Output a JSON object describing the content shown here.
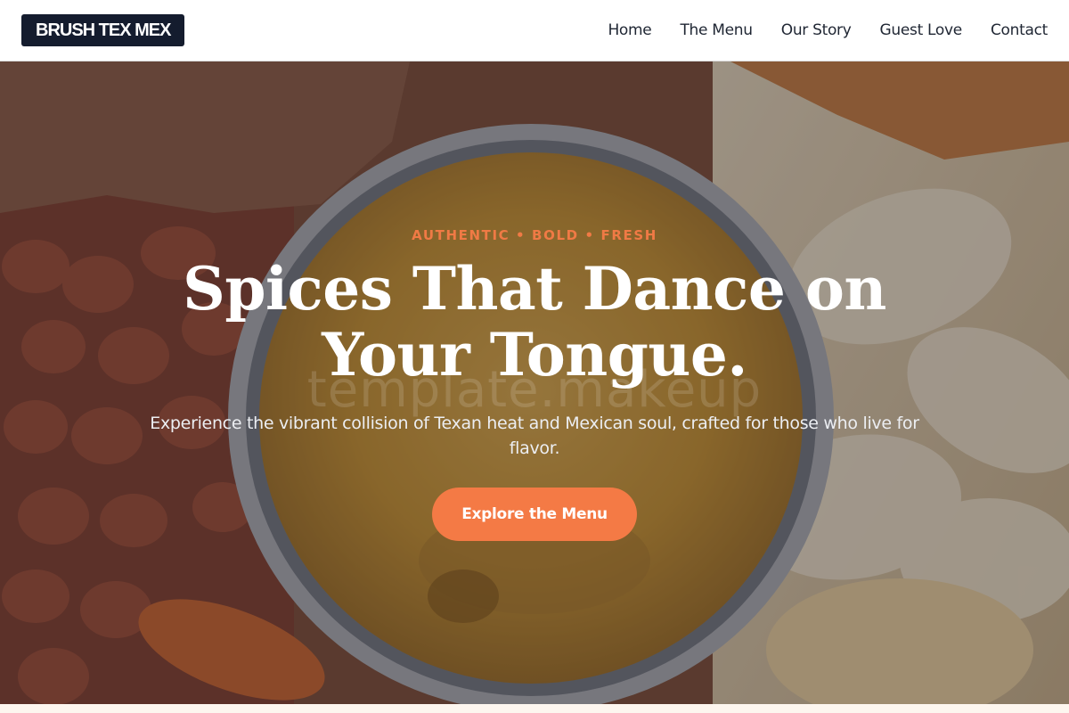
{
  "header": {
    "brand": "BRUSH TEX MEX",
    "nav": [
      {
        "label": "Home"
      },
      {
        "label": "The Menu"
      },
      {
        "label": "Our Story"
      },
      {
        "label": "Guest Love"
      },
      {
        "label": "Contact"
      }
    ]
  },
  "hero": {
    "eyebrow": "AUTHENTIC • BOLD • FRESH",
    "headline": "Spices That Dance on Your Tongue.",
    "watermark": "template.makeup",
    "subtext": "Experience the vibrant collision of Texan heat and Mexican soul, crafted for those who live for flavor.",
    "cta_label": "Explore the Menu",
    "background_image": "cheese-dip-bowl-with-chips-and-snacks"
  },
  "colors": {
    "brand_dark": "#141c2e",
    "accent_orange": "#f47a45",
    "nav_text": "#1f2633",
    "headline_text": "#ffffff"
  }
}
